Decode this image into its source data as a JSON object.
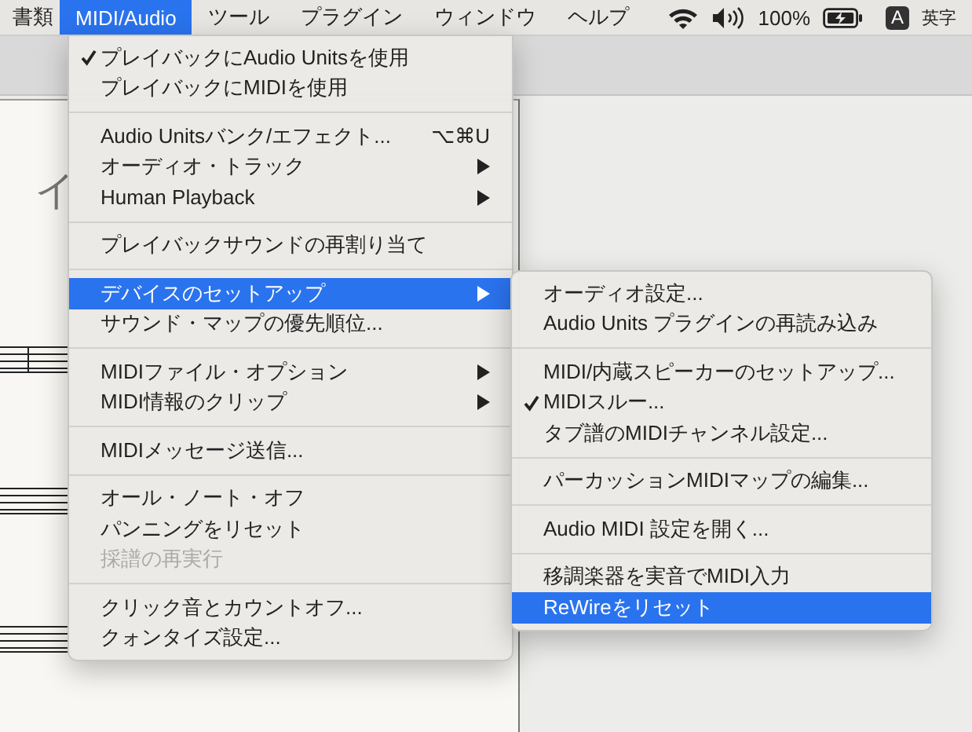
{
  "menubar": {
    "items": [
      {
        "label": "書類",
        "selected": false
      },
      {
        "label": "MIDI/Audio",
        "selected": true
      },
      {
        "label": "ツール",
        "selected": false
      },
      {
        "label": "プラグイン",
        "selected": false
      },
      {
        "label": "ウィンドウ",
        "selected": false
      },
      {
        "label": "ヘルプ",
        "selected": false
      }
    ],
    "battery": "100%",
    "input_badge": "A",
    "input_name": "英字"
  },
  "document": {
    "title_fragment": "イ"
  },
  "menu": {
    "items": [
      {
        "kind": "item",
        "label": "プレイバックにAudio Unitsを使用",
        "checked": true
      },
      {
        "kind": "item",
        "label": "プレイバックにMIDIを使用",
        "checked": false
      },
      {
        "kind": "separator"
      },
      {
        "kind": "item",
        "label": "Audio Unitsバンク/エフェクト...",
        "shortcut": "⌥⌘U",
        "checked": false
      },
      {
        "kind": "item",
        "label": "オーディオ・トラック",
        "submenu": true,
        "checked": false
      },
      {
        "kind": "item",
        "label": "Human Playback",
        "submenu": true,
        "checked": false
      },
      {
        "kind": "separator"
      },
      {
        "kind": "item",
        "label": "プレイバックサウンドの再割り当て",
        "checked": false
      },
      {
        "kind": "separator"
      },
      {
        "kind": "item",
        "label": "デバイスのセットアップ",
        "submenu": true,
        "selected": true,
        "checked": false
      },
      {
        "kind": "item",
        "label": "サウンド・マップの優先順位...",
        "checked": false
      },
      {
        "kind": "separator"
      },
      {
        "kind": "item",
        "label": "MIDIファイル・オプション",
        "submenu": true,
        "checked": false
      },
      {
        "kind": "item",
        "label": "MIDI情報のクリップ",
        "submenu": true,
        "checked": false
      },
      {
        "kind": "separator"
      },
      {
        "kind": "item",
        "label": "MIDIメッセージ送信...",
        "checked": false
      },
      {
        "kind": "separator"
      },
      {
        "kind": "item",
        "label": "オール・ノート・オフ",
        "checked": false
      },
      {
        "kind": "item",
        "label": "パンニングをリセット",
        "checked": false
      },
      {
        "kind": "item",
        "label": "採譜の再実行",
        "disabled": true,
        "checked": false
      },
      {
        "kind": "separator"
      },
      {
        "kind": "item",
        "label": "クリック音とカウントオフ...",
        "checked": false
      },
      {
        "kind": "item",
        "label": "クォンタイズ設定...",
        "checked": false
      }
    ]
  },
  "submenu": {
    "items": [
      {
        "kind": "item",
        "label": "オーディオ設定...",
        "checked": false
      },
      {
        "kind": "item",
        "label": "Audio Units プラグインの再読み込み",
        "checked": false
      },
      {
        "kind": "separator"
      },
      {
        "kind": "item",
        "label": "MIDI/内蔵スピーカーのセットアップ...",
        "checked": false
      },
      {
        "kind": "item",
        "label": "MIDIスルー...",
        "checked": true
      },
      {
        "kind": "item",
        "label": "タブ譜のMIDIチャンネル設定...",
        "checked": false
      },
      {
        "kind": "separator"
      },
      {
        "kind": "item",
        "label": "パーカッションMIDIマップの編集...",
        "checked": false
      },
      {
        "kind": "separator"
      },
      {
        "kind": "item",
        "label": "Audio MIDI 設定を開く...",
        "checked": false
      },
      {
        "kind": "separator"
      },
      {
        "kind": "item",
        "label": "移調楽器を実音でMIDI入力",
        "checked": false
      },
      {
        "kind": "item",
        "label": "ReWireをリセット",
        "selected": true,
        "checked": false
      }
    ]
  }
}
